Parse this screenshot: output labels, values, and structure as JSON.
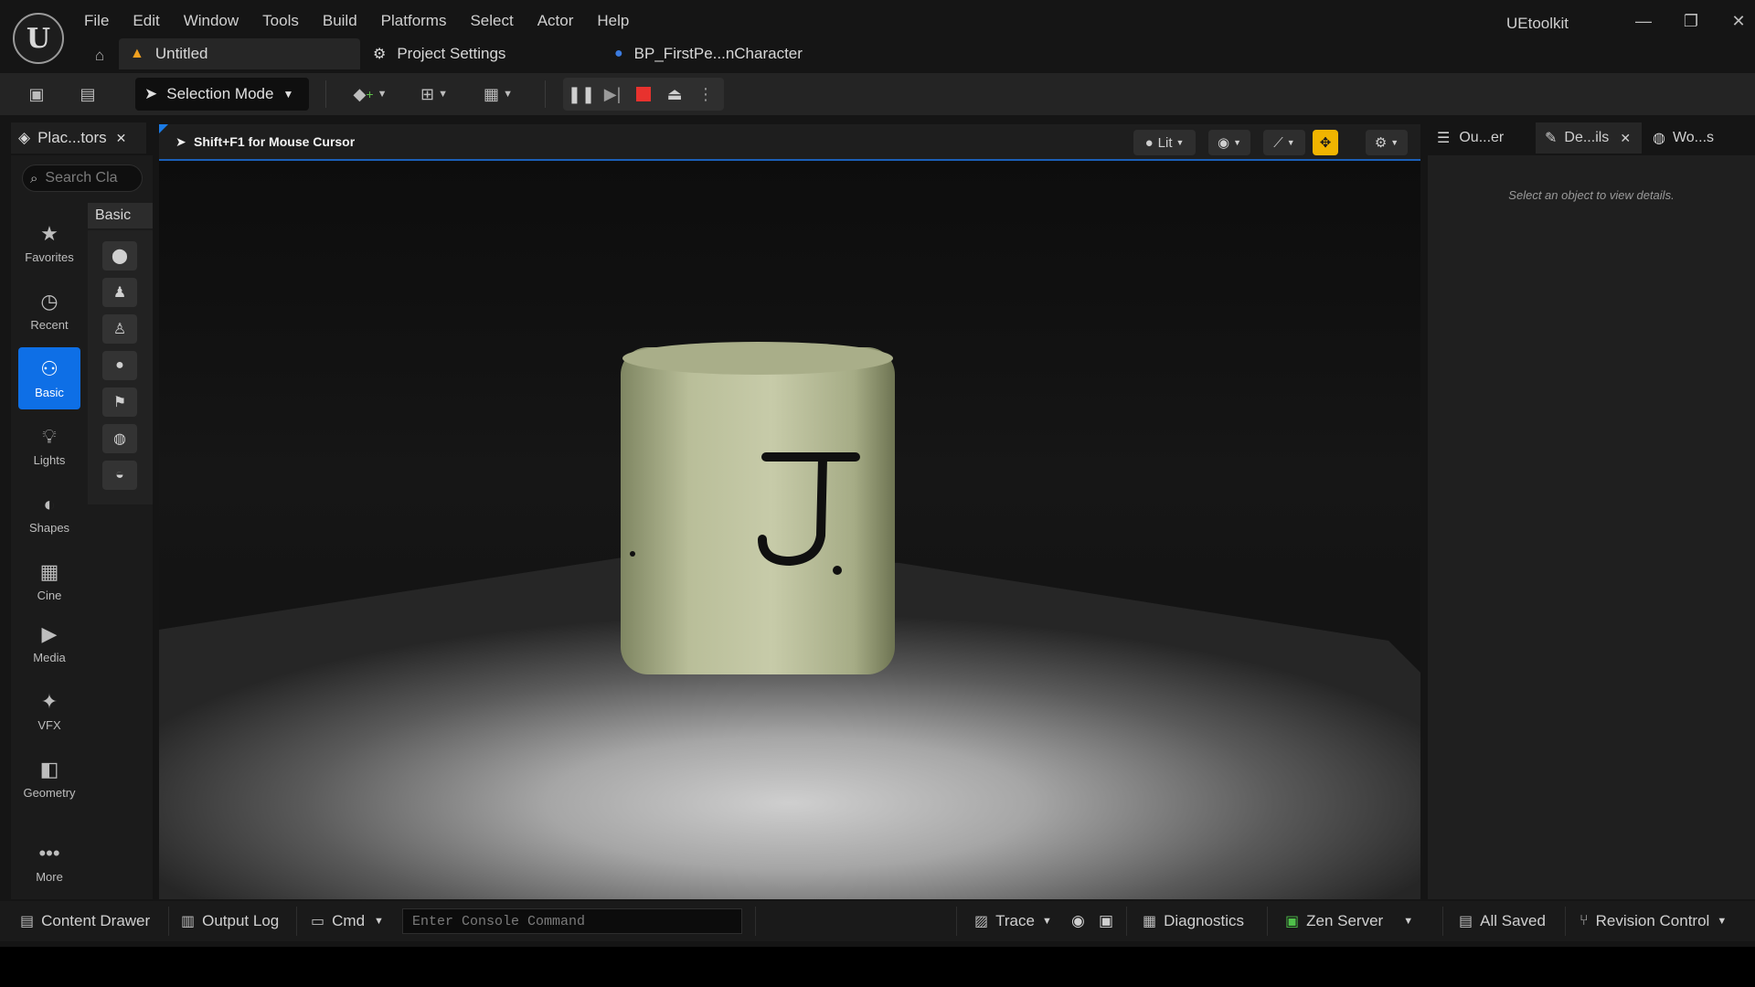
{
  "app": {
    "name": "UEtoolkit",
    "logo_glyph": "U"
  },
  "menu": [
    "File",
    "Edit",
    "Window",
    "Tools",
    "Build",
    "Platforms",
    "Select",
    "Actor",
    "Help"
  ],
  "tabs": [
    {
      "label": "Untitled",
      "icon": "level-warning-icon"
    },
    {
      "label": "Project Settings",
      "icon": "settings-gear-icon"
    },
    {
      "label": "BP_FirstPe...nCharacter",
      "icon": "character-icon"
    }
  ],
  "toolbar": {
    "selection_mode": "Selection Mode"
  },
  "place_actors": {
    "tab_label": "Plac...tors",
    "search_placeholder": "Search Cla",
    "categories": [
      "Favorites",
      "Recent",
      "Basic",
      "Lights",
      "Shapes",
      "Cine",
      "Media",
      "VFX",
      "Geometry",
      "More"
    ],
    "active_category": "Basic",
    "section_title": "Basic"
  },
  "viewport": {
    "hint": "Shift+F1 for Mouse Cursor",
    "view_mode": "Lit",
    "object_letter": "J."
  },
  "right_panel": {
    "tabs": [
      "Ou...er",
      "De...ils",
      "Wo...s"
    ],
    "active_tab": "De...ils",
    "details_empty": "Select an object to view details."
  },
  "statusbar": {
    "content_drawer": "Content Drawer",
    "output_log": "Output Log",
    "cmd": "Cmd",
    "console_placeholder": "Enter Console Command",
    "trace": "Trace",
    "diagnostics": "Diagnostics",
    "zen_server": "Zen Server",
    "all_saved": "All Saved",
    "revision_control": "Revision Control"
  },
  "colors": {
    "accent_blue": "#0e6fe6",
    "stop_red": "#e8322e",
    "highlight_yellow": "#f0b400"
  }
}
